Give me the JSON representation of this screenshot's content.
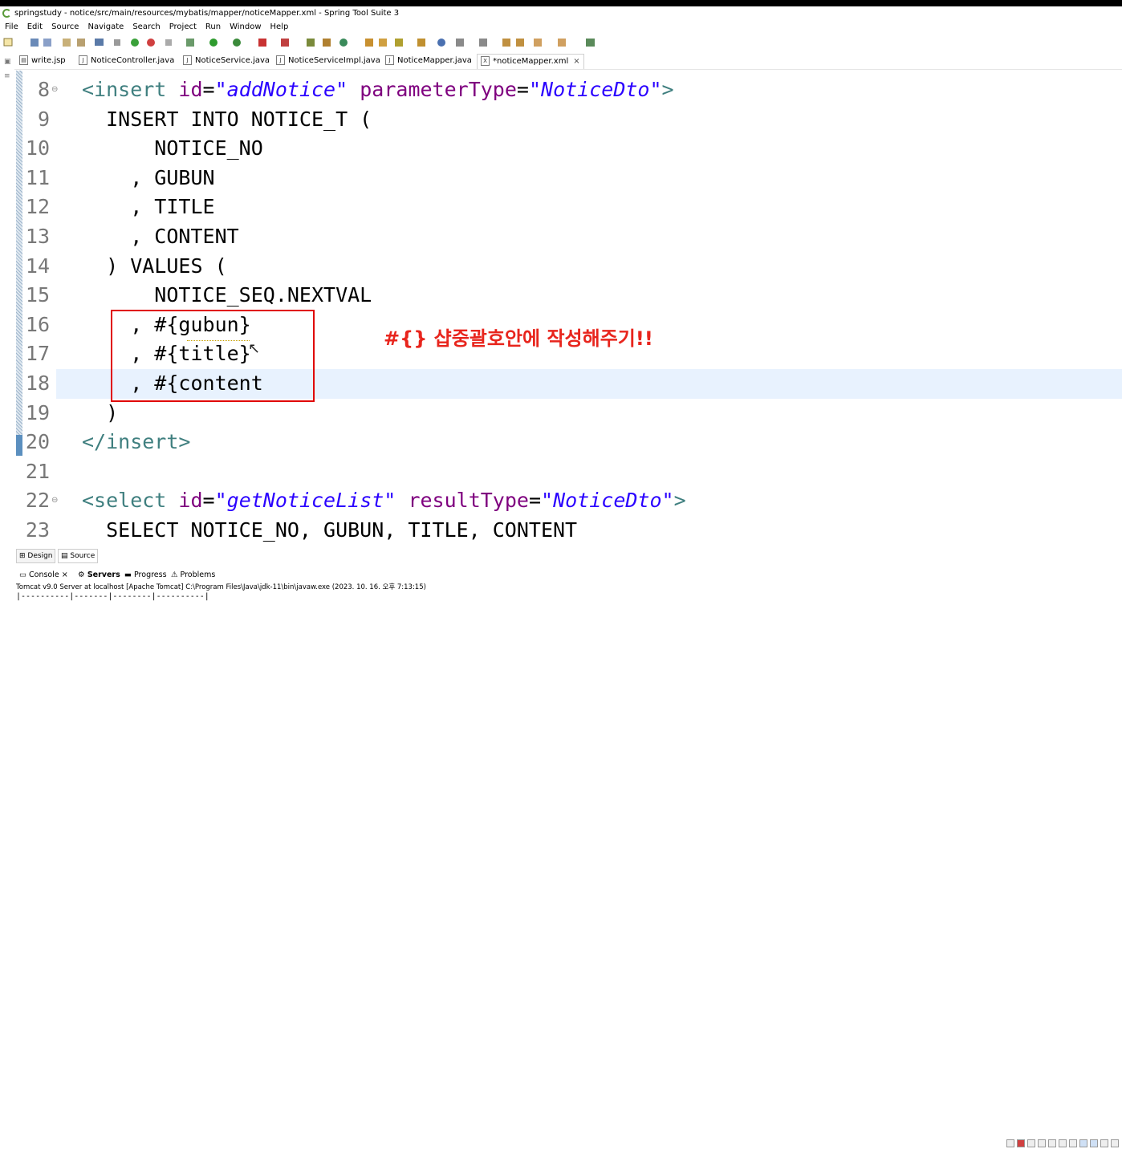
{
  "window": {
    "title": "springstudy - notice/src/main/resources/mybatis/mapper/noticeMapper.xml - Spring Tool Suite 3"
  },
  "menu": [
    "File",
    "Edit",
    "Source",
    "Navigate",
    "Search",
    "Project",
    "Run",
    "Window",
    "Help"
  ],
  "tabs": [
    {
      "label": "write.jsp",
      "icon": "jsp-file-icon",
      "active": false
    },
    {
      "label": "NoticeController.java",
      "icon": "java-file-icon",
      "active": false
    },
    {
      "label": "NoticeService.java",
      "icon": "java-file-icon",
      "active": false
    },
    {
      "label": "NoticeServiceImpl.java",
      "icon": "java-file-icon",
      "active": false
    },
    {
      "label": "NoticeMapper.java",
      "icon": "java-file-icon",
      "active": false
    },
    {
      "label": "*noticeMapper.xml",
      "icon": "xml-file-icon",
      "active": true
    }
  ],
  "tab_close": "×",
  "editor": {
    "lines": [
      {
        "num": "8",
        "fold": true,
        "parts": [
          [
            "tagc",
            "<insert "
          ],
          [
            "attr",
            "id"
          ],
          [
            "plain",
            "="
          ],
          [
            "val",
            "\"addNotice\""
          ],
          [
            "plain",
            " "
          ],
          [
            "attr",
            "parameterType"
          ],
          [
            "plain",
            "="
          ],
          [
            "val",
            "\"NoticeDto\""
          ],
          [
            "tagc",
            ">"
          ]
        ]
      },
      {
        "num": "9",
        "parts": [
          [
            "plain",
            "  INSERT INTO NOTICE_T ("
          ]
        ]
      },
      {
        "num": "10",
        "parts": [
          [
            "plain",
            "      NOTICE_NO"
          ]
        ]
      },
      {
        "num": "11",
        "parts": [
          [
            "plain",
            "    , GUBUN"
          ]
        ]
      },
      {
        "num": "12",
        "parts": [
          [
            "plain",
            "    , TITLE"
          ]
        ]
      },
      {
        "num": "13",
        "parts": [
          [
            "plain",
            "    , CONTENT"
          ]
        ]
      },
      {
        "num": "14",
        "parts": [
          [
            "plain",
            "  ) VALUES ("
          ]
        ]
      },
      {
        "num": "15",
        "parts": [
          [
            "plain",
            "      NOTICE_SEQ.NEXTVAL"
          ]
        ]
      },
      {
        "num": "16",
        "parts": [
          [
            "plain",
            "    , #{gubun}"
          ]
        ]
      },
      {
        "num": "17",
        "parts": [
          [
            "plain",
            "    , #{title}"
          ]
        ]
      },
      {
        "num": "18",
        "highlight": true,
        "parts": [
          [
            "plain",
            "    , #{content"
          ]
        ]
      },
      {
        "num": "19",
        "parts": [
          [
            "plain",
            "  )"
          ]
        ]
      },
      {
        "num": "20",
        "parts": [
          [
            "tagc",
            "</insert>"
          ]
        ]
      },
      {
        "num": "21",
        "parts": [
          [
            "plain",
            ""
          ]
        ]
      },
      {
        "num": "22",
        "fold": true,
        "parts": [
          [
            "tagc",
            "<select "
          ],
          [
            "attr",
            "id"
          ],
          [
            "plain",
            "="
          ],
          [
            "val",
            "\"getNoticeList\""
          ],
          [
            "plain",
            " "
          ],
          [
            "attr",
            "resultType"
          ],
          [
            "plain",
            "="
          ],
          [
            "val",
            "\"NoticeDto\""
          ],
          [
            "tagc",
            ">"
          ]
        ]
      },
      {
        "num": "23",
        "parts": [
          [
            "plain",
            "  SELECT NOTICE_NO, GUBUN, TITLE, CONTENT"
          ]
        ]
      }
    ]
  },
  "annotation": {
    "text": "#{} 샵중괄호안에 작성해주기!!",
    "color": "#e8251d"
  },
  "editor_tabs": [
    {
      "label": "Design"
    },
    {
      "label": "Source"
    }
  ],
  "console_tabs": [
    {
      "label": "Console",
      "close": "×"
    },
    {
      "label": "Servers"
    },
    {
      "label": "Progress"
    },
    {
      "label": "Problems"
    }
  ],
  "console": {
    "info": "Tomcat v9.0 Server at localhost [Apache Tomcat] C:\\Program Files\\Java\\jdk-11\\bin\\javaw.exe  (2023. 10. 16. 오후 7:13:15)",
    "output": "|----------|-------|--------|----------|"
  }
}
